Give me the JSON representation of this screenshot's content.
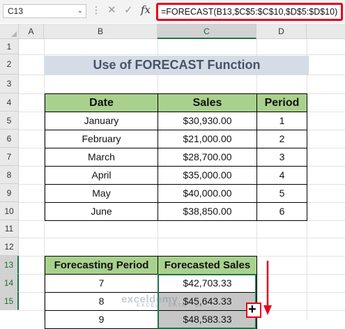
{
  "formula_bar": {
    "name_box": "C13",
    "fx_label": "fx",
    "formula": "=FORECAST(B13,$C$5:$C$10,$D$5:$D$10)"
  },
  "columns": [
    "A",
    "B",
    "C",
    "D"
  ],
  "rows": [
    "1",
    "2",
    "3",
    "4",
    "5",
    "6",
    "7",
    "8",
    "9",
    "10",
    "11",
    "12",
    "13",
    "14",
    "15"
  ],
  "title": "Use of FORECAST Function",
  "sales_table": {
    "headers": [
      "Date",
      "Sales",
      "Period"
    ],
    "rows": [
      [
        "January",
        "$30,930.00",
        "1"
      ],
      [
        "February",
        "$21,000.00",
        "2"
      ],
      [
        "March",
        "$28,700.00",
        "3"
      ],
      [
        "April",
        "$35,000.00",
        "4"
      ],
      [
        "May",
        "$40,000.00",
        "5"
      ],
      [
        "June",
        "$38,850.00",
        "6"
      ]
    ]
  },
  "forecast_table": {
    "headers": [
      "Forecasting Period",
      "Forecasted Sales"
    ],
    "rows": [
      [
        "7",
        "$42,703.33"
      ],
      [
        "8",
        "$45,643.33"
      ],
      [
        "9",
        "$48,583.33"
      ]
    ]
  },
  "watermark": {
    "name": "exceldemy",
    "tagline": "EXCEL · DATA · BI"
  },
  "colors": {
    "title_bg": "#d5dce6",
    "title_text": "#44546a",
    "header_bg": "#a9d18e",
    "selection": "#217346",
    "highlight_red": "#e8001c"
  }
}
